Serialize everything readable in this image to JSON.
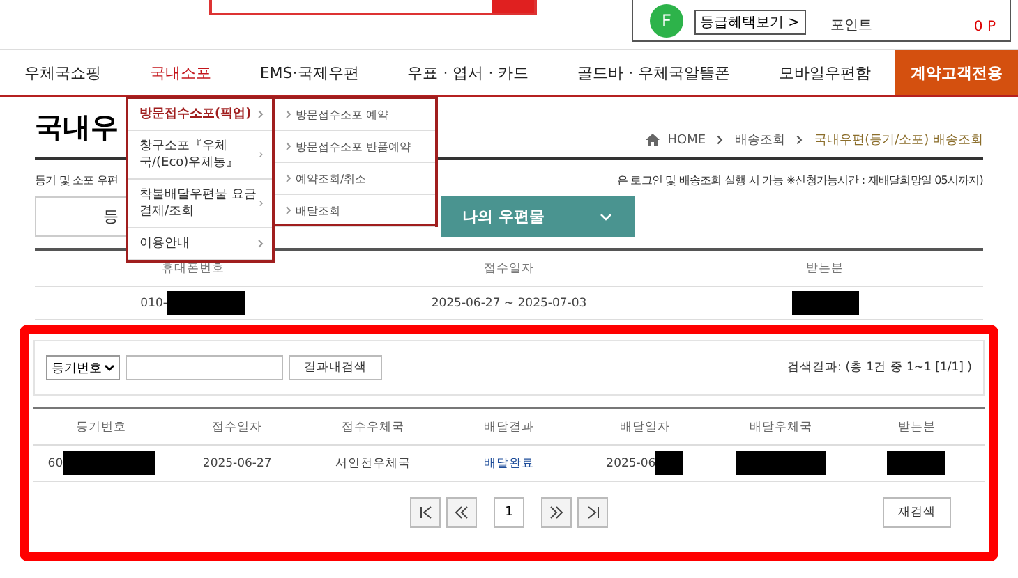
{
  "header": {
    "badge": "F",
    "benefit_button": "등급혜택보기 >",
    "point_label": "포인트",
    "point_value": "0 P"
  },
  "nav": [
    {
      "label": "우체국쇼핑",
      "selected": false,
      "kind": "plain"
    },
    {
      "label": "국내소포",
      "selected": true,
      "kind": "plain"
    },
    {
      "label": "EMS·국제우편",
      "selected": false,
      "kind": "plain"
    },
    {
      "label": "우표 · 엽서 · 카드",
      "selected": false,
      "kind": "plain"
    },
    {
      "label": "골드바 · 우체국알뜰폰",
      "selected": false,
      "kind": "plain"
    },
    {
      "label": "모바일우편함",
      "selected": false,
      "kind": "plain"
    },
    {
      "label": "계약고객전용",
      "selected": false,
      "kind": "special"
    }
  ],
  "dropdown": {
    "items": [
      {
        "label": "방문접수소포(픽업)",
        "selected": true
      },
      {
        "label": "창구소포『우체국/(Eco)우체통』",
        "selected": false
      },
      {
        "label": "착불배달우편물 요금 결제/조회",
        "selected": false
      },
      {
        "label": "이용안내",
        "selected": false
      }
    ],
    "submenu": [
      "방문접수소포 예약",
      "방문접수소포 반품예약",
      "예약조회/취소",
      "배달조회"
    ]
  },
  "page_title": "국내우",
  "breadcrumb": [
    "HOME",
    "배송조회",
    "국내우편(등기/소포) 배송조회"
  ],
  "notice_left": "등기 및 소포 우편",
  "notice_right": "은 로그인 및 배송조회 실행 시 가능 ※신청가능시간 : 재배달희망일 05시까지)",
  "tabs": [
    {
      "label": "등",
      "selected": false
    },
    {
      "label": "나의 우편물",
      "selected": true
    }
  ],
  "summary": {
    "columns": [
      "휴대폰번호",
      "접수일자",
      "받는분"
    ],
    "row": [
      "010-",
      "2025-06-27 ~ 2025-07-03"
    ]
  },
  "search": {
    "select": "등기번호",
    "button": "결과내검색",
    "result": "검색결과: (총 1건 중 1~1  [1/1] )"
  },
  "results": {
    "columns": [
      "등기번호",
      "접수일자",
      "접수우체국",
      "배달결과",
      "배달일자",
      "배달우체국",
      "받는분"
    ],
    "row": [
      "60",
      "2025-06-27",
      "서인천우체국",
      "배달완료",
      "2025-06"
    ]
  },
  "pagination": {
    "page": "1"
  },
  "research_button": "재검색"
}
